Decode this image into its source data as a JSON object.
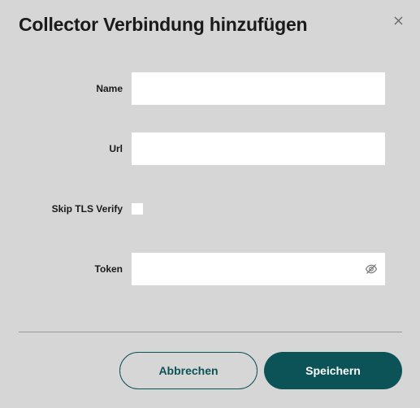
{
  "dialog": {
    "title": "Collector Verbindung hinzufügen",
    "close_icon": "close-icon"
  },
  "form": {
    "name_label": "Name",
    "name_value": "",
    "url_label": "Url",
    "url_value": "",
    "skip_tls_label": "Skip TLS Verify",
    "skip_tls_checked": false,
    "token_label": "Token",
    "token_value": "",
    "token_visibility_icon": "eye-off-icon"
  },
  "actions": {
    "cancel_label": "Abbrechen",
    "save_label": "Speichern"
  },
  "colors": {
    "primary": "#0b5357",
    "background": "#d6d6d6",
    "field_background": "#ffffff"
  }
}
